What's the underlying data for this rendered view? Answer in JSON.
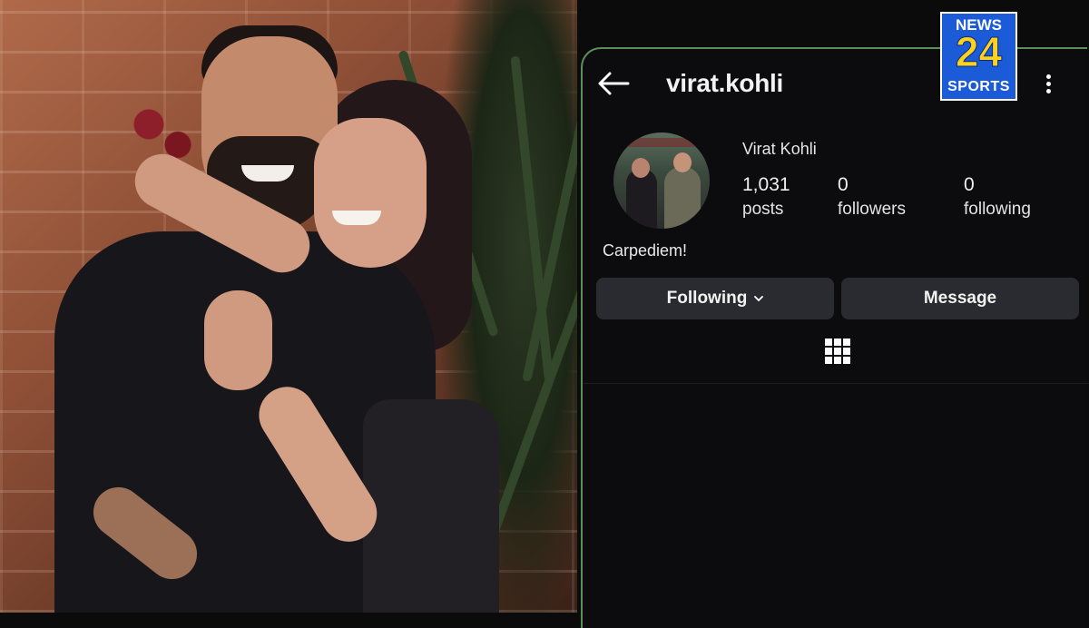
{
  "logo": {
    "line1": "NEWS",
    "line2": "24",
    "line3": "SPORTS"
  },
  "profile": {
    "username": "virat.kohli",
    "display_name": "Virat Kohli",
    "stats": [
      {
        "value": "1,031",
        "label": "posts"
      },
      {
        "value": "0",
        "label": "followers"
      },
      {
        "value": "0",
        "label": "following"
      }
    ],
    "bio": "Carpediem!"
  },
  "actions": {
    "following_label": "Following",
    "message_label": "Message"
  },
  "icons": {
    "back": "arrow-left-icon",
    "more": "more-vertical-icon",
    "grid": "grid-icon",
    "chevron": "chevron-down-icon"
  },
  "colors": {
    "app_background": "#0c0c0e",
    "button_background": "#2a2b30",
    "logo_blue": "#1b5bd8",
    "logo_yellow": "#ffd21e"
  }
}
